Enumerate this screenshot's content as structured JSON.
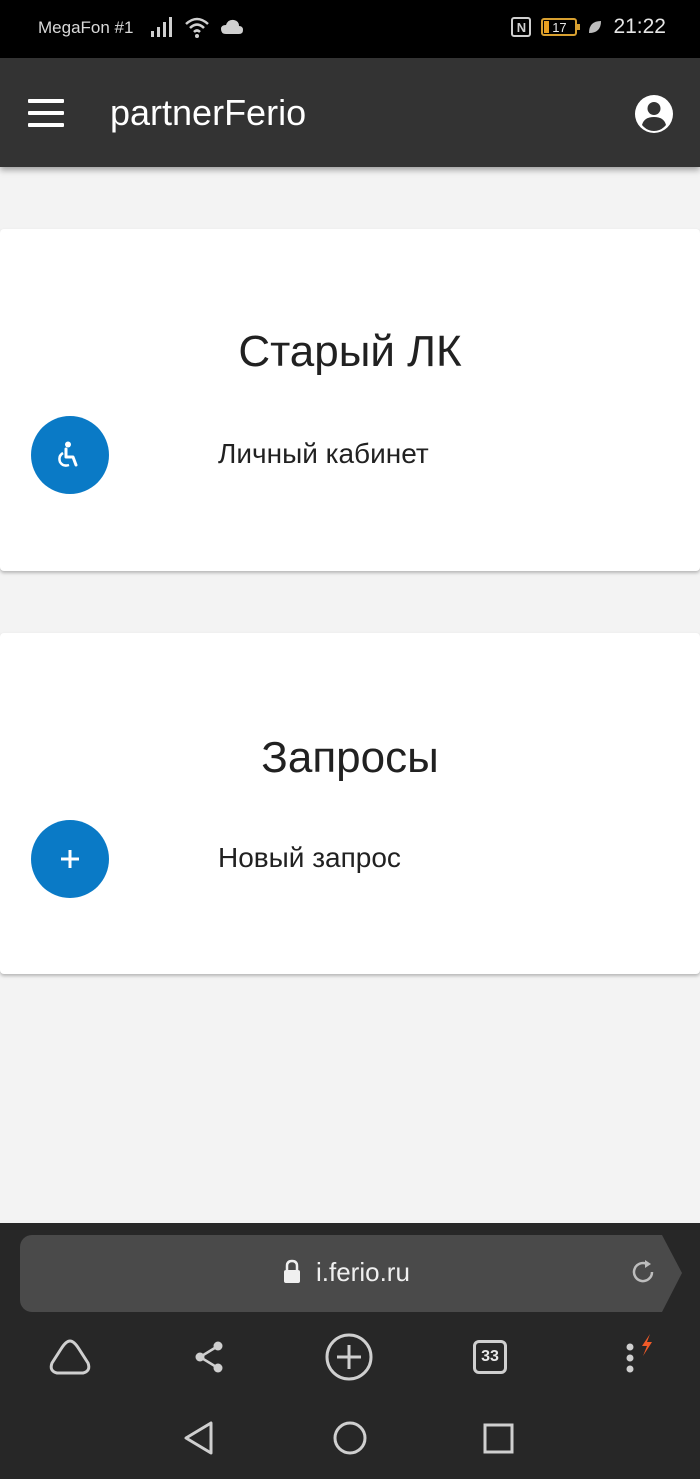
{
  "status_bar": {
    "carrier": "MegaFon #1",
    "nfc": "N",
    "battery_level": "17",
    "battery_fraction": 0.17,
    "time": "21:22",
    "icons": [
      "signal-icon",
      "wifi-icon",
      "cloud-icon",
      "nfc-icon",
      "battery-icon",
      "leaf-icon"
    ]
  },
  "app_bar": {
    "title": "partnerFerio",
    "menu_icon": "hamburger-menu-icon",
    "account_icon": "account-circle-icon",
    "background": "#333333"
  },
  "cards": [
    {
      "title": "Старый ЛК",
      "action_label": "Личный кабинет",
      "action_icon": "accessible-icon"
    },
    {
      "title": "Запросы",
      "action_label": "Новый запрос",
      "action_icon": "plus-icon"
    }
  ],
  "accent_color": "#0a7ac6",
  "browser": {
    "url": "i.ferio.ru",
    "tabs_count": "33",
    "toolbar_icons": [
      "alice-icon",
      "share-icon",
      "new-tab-icon",
      "tabs-icon",
      "more-icon"
    ],
    "nav_icons": [
      "back-icon",
      "home-icon",
      "recents-icon"
    ]
  }
}
